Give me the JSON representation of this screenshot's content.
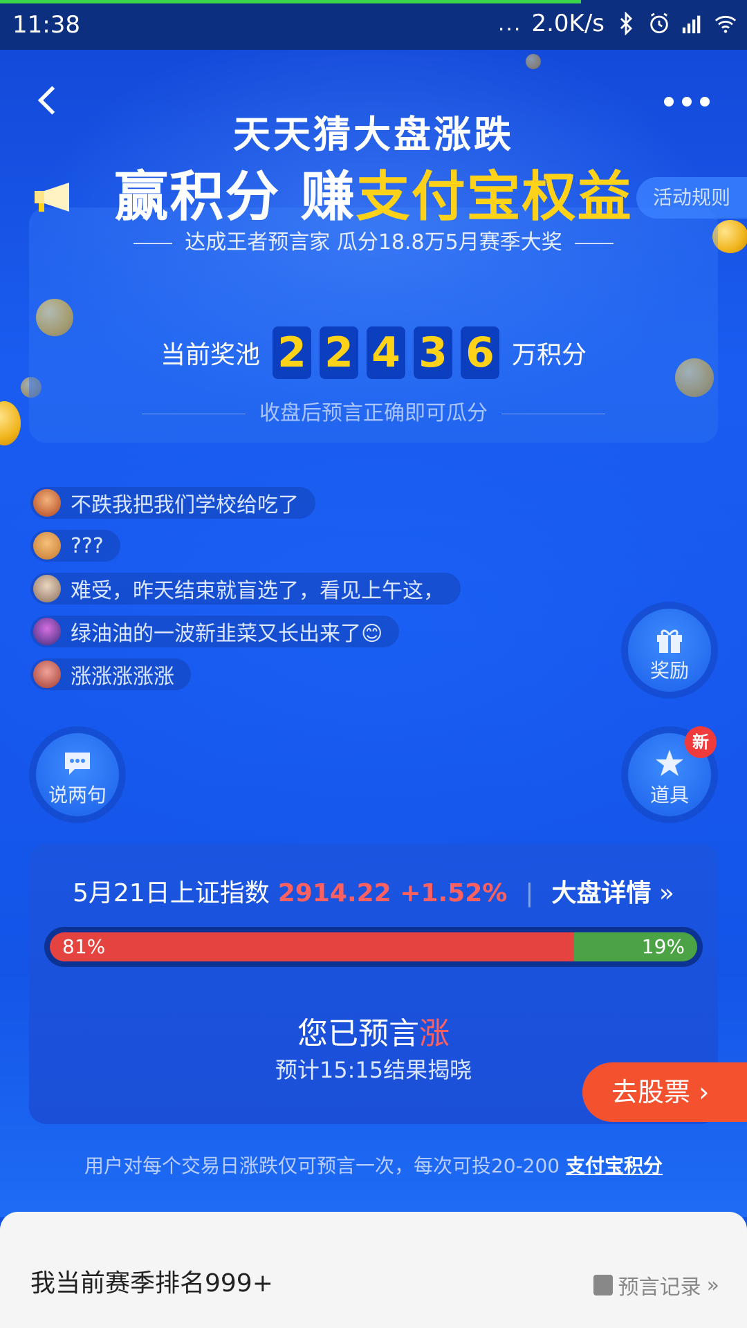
{
  "status_bar": {
    "time": "11:38",
    "dots": "...",
    "speed": "2.0K/s"
  },
  "header": {
    "title_line1": "天天猜大盘涨跌",
    "title_line2_plain": "赢积分 赚",
    "title_line2_highlight": "支付宝权益",
    "subtitle": "达成王者预言家 瓜分18.8万5月赛季大奖",
    "rules_button": "活动规则"
  },
  "pool": {
    "label": "当前奖池",
    "digits": [
      "2",
      "2",
      "4",
      "3",
      "6"
    ],
    "unit": "万积分",
    "note": "收盘后预言正确即可瓜分"
  },
  "comments": [
    {
      "text": "不跌我把我们学校给吃了"
    },
    {
      "text": "???"
    },
    {
      "text": "难受，昨天结束就盲选了，看见上午这，"
    },
    {
      "text": "绿油油的一波新韭菜又长出来了😊"
    },
    {
      "text": "涨涨涨涨涨"
    }
  ],
  "fabs": {
    "reward": "奖励",
    "chat": "说两句",
    "props": "道具",
    "new_badge": "新"
  },
  "index": {
    "label": "5月21日上证指数",
    "value": "2914.22 +1.52%",
    "separator": "|",
    "detail": "大盘详情",
    "detail_arrow": "»",
    "up_pct": "81%",
    "down_pct": "19%",
    "up_fraction": 0.81,
    "predicted_prefix": "您已预言",
    "predicted_dir": "涨",
    "reveal_time": "预计15:15结果揭晓",
    "goto_stock": "去股票",
    "goto_arrow": "›"
  },
  "rule_note": {
    "text": "用户对每个交易日涨跌仅可预言一次，每次可投20-200",
    "link": "支付宝积分"
  },
  "bottom": {
    "rank": "我当前赛季排名999+",
    "record": "预言记录",
    "record_arrow": "»"
  },
  "colors": {
    "accent_yellow": "#ffd21a",
    "rise_red": "#e5433f",
    "fall_green": "#4ca346",
    "cta_orange": "#f4522f"
  }
}
